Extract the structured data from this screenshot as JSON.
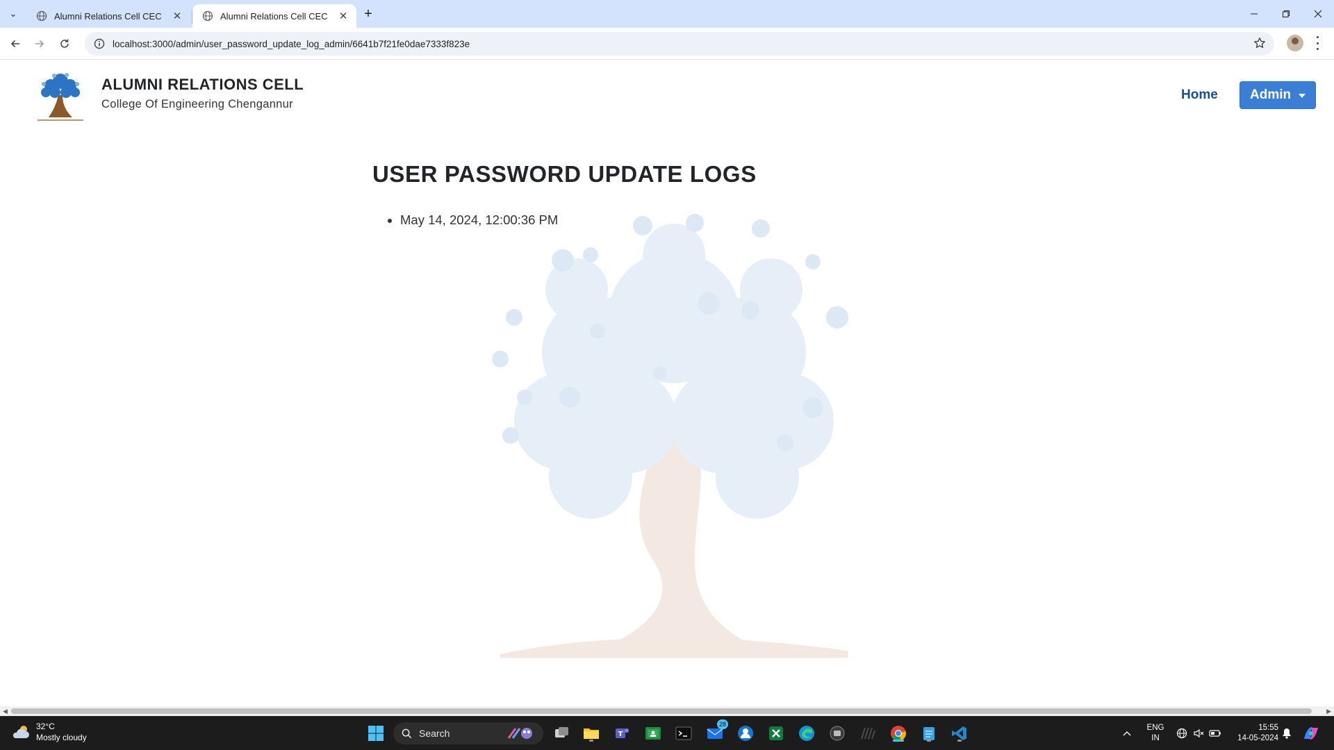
{
  "browser": {
    "tabs": [
      {
        "title": "Alumni Relations Cell CEC",
        "active": false
      },
      {
        "title": "Alumni Relations Cell CEC",
        "active": true
      }
    ],
    "url": "localhost:3000/admin/user_password_update_log_admin/6641b7f21fe0dae7333f823e"
  },
  "site": {
    "title": "ALUMNI RELATIONS CELL",
    "subtitle": "College Of Engineering Chengannur",
    "nav": {
      "home": "Home",
      "admin": "Admin"
    }
  },
  "main": {
    "heading": "USER PASSWORD UPDATE LOGS",
    "logs": [
      "May 14, 2024, 12:00:36 PM"
    ]
  },
  "taskbar": {
    "weather": {
      "temp": "32°C",
      "condition": "Mostly cloudy"
    },
    "search_label": "Search",
    "mail_badge": "28",
    "language": {
      "line1": "ENG",
      "line2": "IN"
    },
    "clock": {
      "time": "15:55",
      "date": "14-05-2024"
    }
  },
  "colors": {
    "tab_strip": "#d3e3fd",
    "brand_blue": "#1d4e8c",
    "admin_button": "#3a7fd5",
    "taskbar": "#1c1c1c"
  }
}
